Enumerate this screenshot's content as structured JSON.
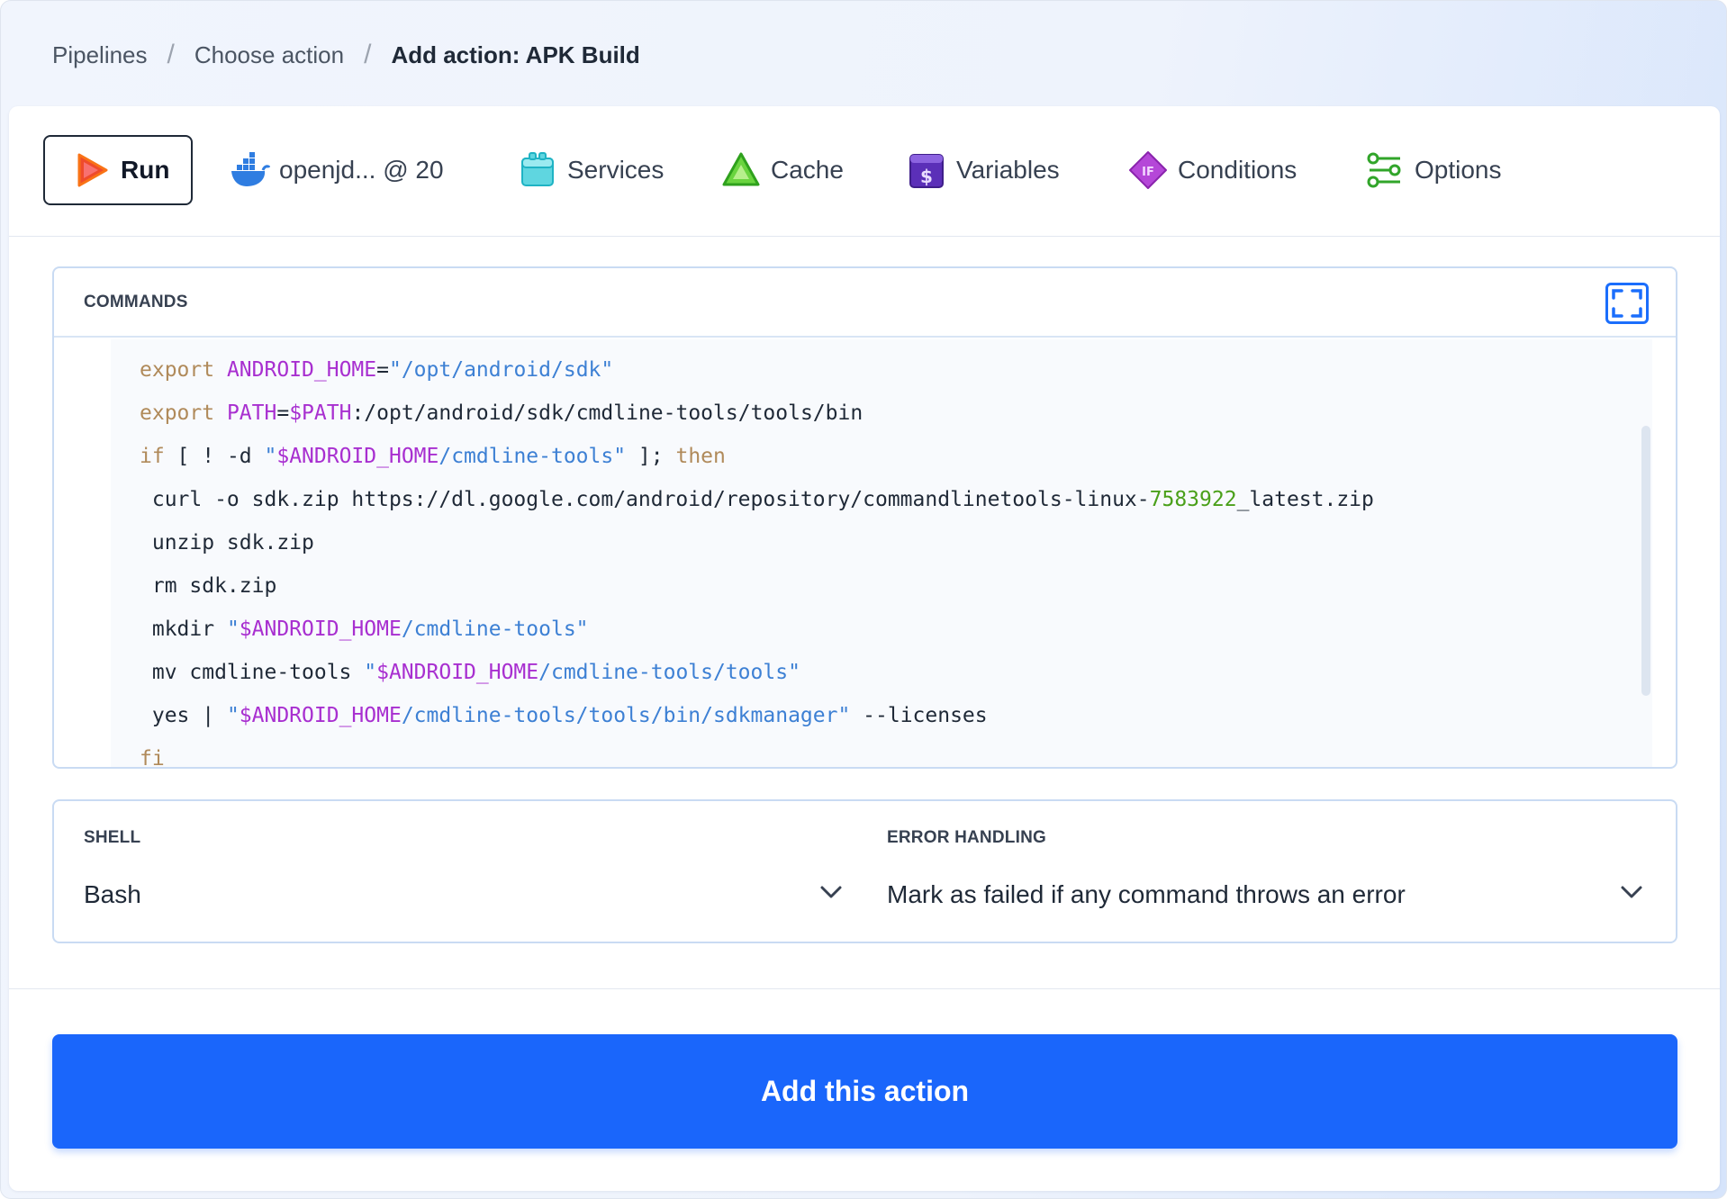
{
  "breadcrumb": {
    "items": [
      "Pipelines",
      "Choose action",
      "Add action: APK Build"
    ],
    "separator": "/"
  },
  "tabs": [
    {
      "label": "Run",
      "icon": "play-icon",
      "active": true
    },
    {
      "label": "openjd... @ 20",
      "icon": "docker-whale-icon",
      "active": false
    },
    {
      "label": "Services",
      "icon": "services-box-icon",
      "active": false
    },
    {
      "label": "Cache",
      "icon": "cache-triangle-icon",
      "active": false
    },
    {
      "label": "Variables",
      "icon": "variables-dollar-icon",
      "active": false
    },
    {
      "label": "Conditions",
      "icon": "conditions-if-icon",
      "active": false
    },
    {
      "label": "Options",
      "icon": "options-sliders-icon",
      "active": false
    }
  ],
  "commands": {
    "title": "COMMANDS",
    "expand_icon": "fullscreen-icon",
    "lines": [
      [
        {
          "t": "export",
          "c": "kw"
        },
        {
          "t": " "
        },
        {
          "t": "ANDROID_HOME",
          "c": "var"
        },
        {
          "t": "="
        },
        {
          "t": "\"/opt/android/sdk\"",
          "c": "str"
        }
      ],
      [
        {
          "t": "export",
          "c": "kw"
        },
        {
          "t": " "
        },
        {
          "t": "PATH",
          "c": "var"
        },
        {
          "t": "="
        },
        {
          "t": "$PATH",
          "c": "var"
        },
        {
          "t": ":/opt/android/sdk/cmdline-tools/tools/bin"
        }
      ],
      [
        {
          "t": "if",
          "c": "kw"
        },
        {
          "t": " [ ! -d "
        },
        {
          "t": "\"",
          "c": "str"
        },
        {
          "t": "$ANDROID_HOME",
          "c": "var"
        },
        {
          "t": "/cmdline-tools\"",
          "c": "str"
        },
        {
          "t": " ]; "
        },
        {
          "t": "then",
          "c": "kw"
        }
      ],
      [
        {
          "t": " curl -o sdk.zip https://dl.google.com/android/repository/commandlinetools-linux-"
        },
        {
          "t": "7583922",
          "c": "num"
        },
        {
          "t": "_latest.zip"
        }
      ],
      [
        {
          "t": " unzip sdk.zip"
        }
      ],
      [
        {
          "t": " rm sdk.zip"
        }
      ],
      [
        {
          "t": " mkdir "
        },
        {
          "t": "\"",
          "c": "str"
        },
        {
          "t": "$ANDROID_HOME",
          "c": "var"
        },
        {
          "t": "/cmdline-tools\"",
          "c": "str"
        }
      ],
      [
        {
          "t": " mv cmdline-tools "
        },
        {
          "t": "\"",
          "c": "str"
        },
        {
          "t": "$ANDROID_HOME",
          "c": "var"
        },
        {
          "t": "/cmdline-tools/tools\"",
          "c": "str"
        }
      ],
      [
        {
          "t": " yes | "
        },
        {
          "t": "\"",
          "c": "str"
        },
        {
          "t": "$ANDROID_HOME",
          "c": "var"
        },
        {
          "t": "/cmdline-tools/tools/bin/sdkmanager\"",
          "c": "str"
        },
        {
          "t": " --licenses"
        }
      ],
      [
        {
          "t": "fi",
          "c": "kw"
        }
      ]
    ]
  },
  "shell": {
    "label": "SHELL",
    "value": "Bash"
  },
  "error_handling": {
    "label": "ERROR HANDLING",
    "value": "Mark as failed if any command throws an error"
  },
  "cta": {
    "label": "Add this action"
  },
  "colors": {
    "primary": "#1a66fb",
    "keyword": "#b08a5a",
    "variable": "#a82fd0",
    "string": "#3d80d4",
    "number": "#4aa01a"
  }
}
